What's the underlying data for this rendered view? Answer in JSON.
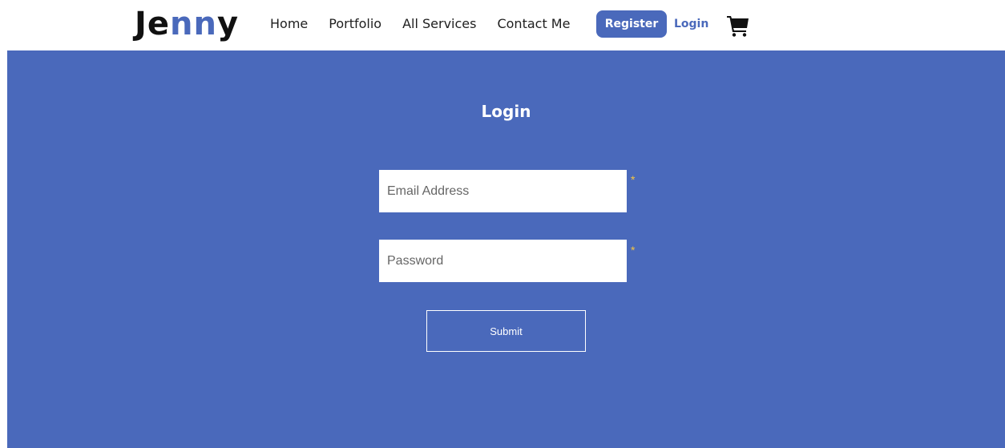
{
  "header": {
    "logo": {
      "part1": "Je",
      "part2": "nn",
      "part3": "y"
    },
    "nav": [
      "Home",
      "Portfolio",
      "All Services",
      "Contact Me"
    ],
    "register_label": "Register",
    "login_label": "Login",
    "cart_icon": "shopping-cart-icon"
  },
  "main": {
    "title": "Login",
    "email": {
      "placeholder": "Email Address",
      "value": ""
    },
    "password": {
      "placeholder": "Password",
      "value": ""
    },
    "required_marker": "*",
    "submit_label": "Submit"
  },
  "colors": {
    "brand": "#4a69bb",
    "required": "#f5c542",
    "text_dark": "#1e1e1e"
  }
}
